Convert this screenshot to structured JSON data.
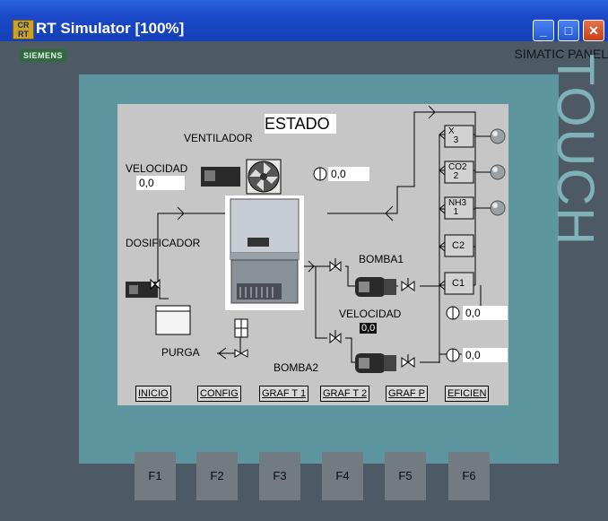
{
  "window": {
    "title": "RT Simulator [100%]",
    "app_icon": "CR\nRT"
  },
  "panel": {
    "brand": "SIEMENS",
    "name": "SIMATIC PANEL",
    "touch_label": "TOUCH"
  },
  "hmi": {
    "estado": "ESTADO",
    "ventilador": "VENTILADOR",
    "velocidad_label": "VELOCIDAD",
    "velocidad_value": "0,0",
    "dosificador": "DOSIFICADOR",
    "purga": "PURGA",
    "bomba1": "BOMBA1",
    "bomba2": "BOMBA2",
    "velocidad2_label": "VELOCIDAD",
    "velocidad2_value": "0,0",
    "sensor_top": "0,0",
    "sensor_mid": "0,0",
    "sensor_bottom": "0,0",
    "analyzers": [
      {
        "top": "X",
        "bottom": "3"
      },
      {
        "top": "CO2",
        "bottom": "2"
      },
      {
        "top": "NH3",
        "bottom": "1"
      },
      {
        "top": "C2",
        "bottom": ""
      },
      {
        "top": "C1",
        "bottom": ""
      }
    ]
  },
  "nav": [
    "INICIO",
    "CONFIG",
    "GRAF T 1",
    "GRAF T 2",
    "GRAF P",
    "EFICIEN"
  ],
  "fkeys": [
    "F1",
    "F2",
    "F3",
    "F4",
    "F5",
    "F6"
  ],
  "colors": {
    "titlebar": "#1a48c8",
    "frame": "#5e96a0",
    "screen": "#c6c6c6",
    "brand": "#2f6b3e"
  }
}
